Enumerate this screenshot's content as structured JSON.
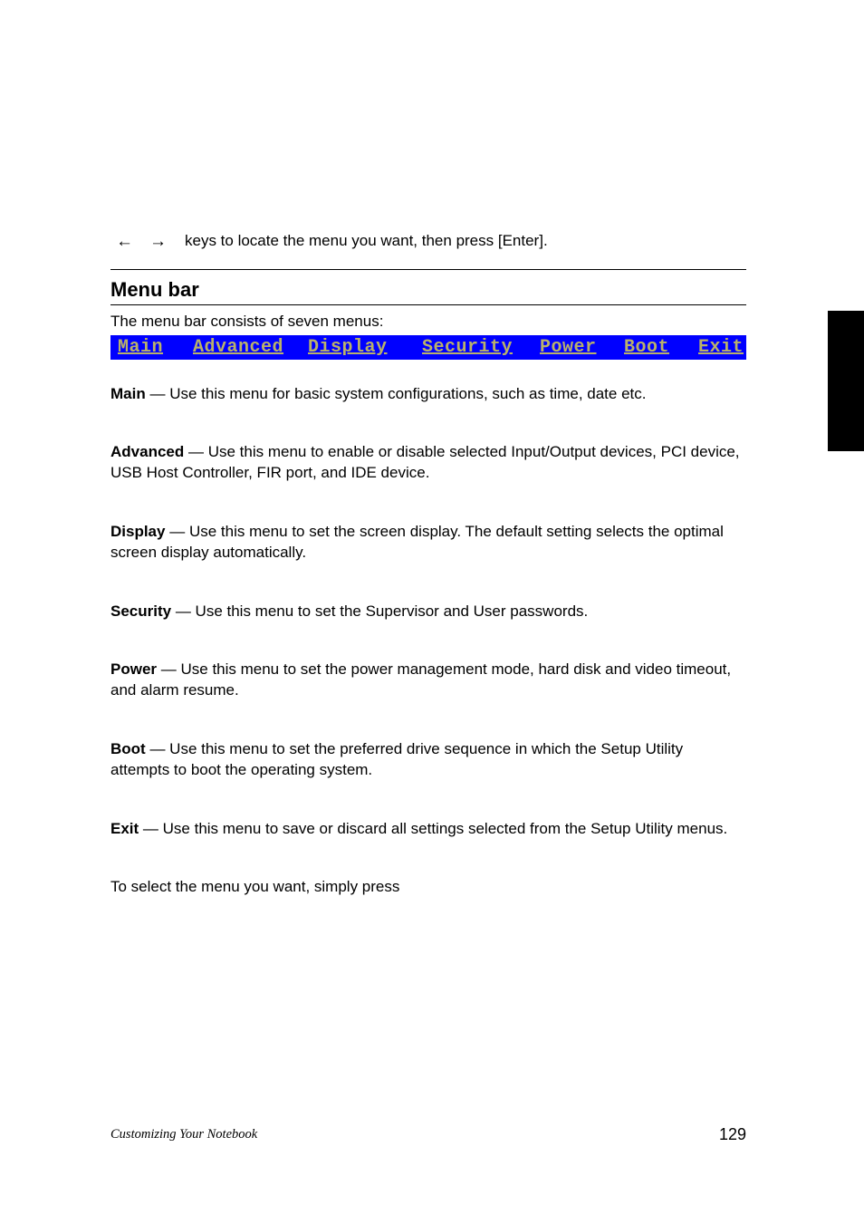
{
  "nav": {
    "arrow_left": "←",
    "arrow_right": "→",
    "text": "keys to locate the menu you want, then press [Enter]."
  },
  "heading": "Menu bar",
  "intro": "The menu bar consists of seven menus:",
  "bios_tabs": [
    "Main",
    "Advanced",
    "Display",
    "Security",
    "Power",
    "Boot",
    "Exit"
  ],
  "items": [
    {
      "name": "Main",
      "desc": "Use this menu for basic system configurations, such as time, date etc."
    },
    {
      "name": "Advanced",
      "desc": "Use this menu to enable or disable selected Input/Output devices, PCI device, USB Host Controller, FIR port, and IDE device."
    },
    {
      "name": "Display",
      "desc": "Use this menu to set the screen display. The default setting selects the optimal screen display automatically."
    },
    {
      "name": "Security",
      "desc": "Use this menu to set the Supervisor and User passwords."
    },
    {
      "name": "Power",
      "desc": "Use this menu to set the power management mode, hard disk and video timeout, and alarm resume."
    },
    {
      "name": "Boot",
      "desc": "Use this menu to set the preferred drive sequence in which the Setup Utility attempts to boot the operating system."
    },
    {
      "name": "Exit",
      "desc": "Use this menu to save or discard all settings selected from the Setup Utility menus."
    }
  ],
  "closing": "To select the menu you want, simply press",
  "footer": {
    "title": "Customizing Your Notebook",
    "page": "129"
  }
}
